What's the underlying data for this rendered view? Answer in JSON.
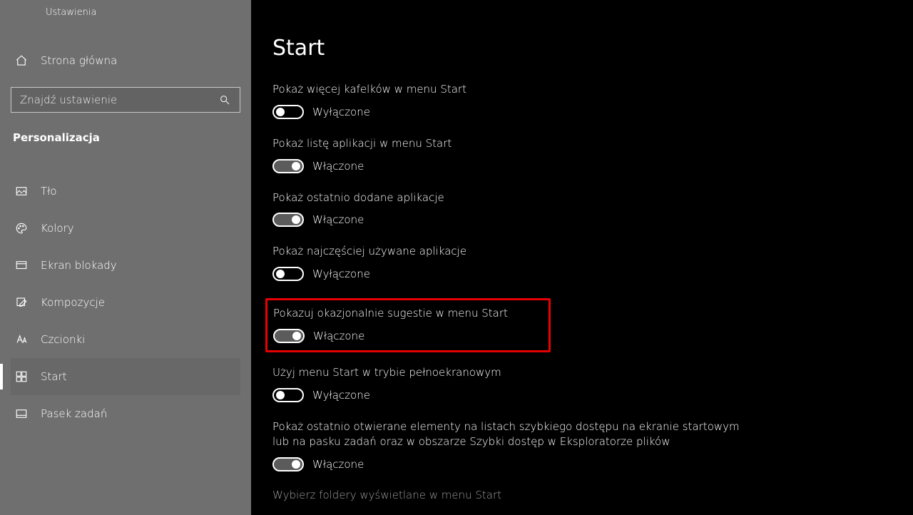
{
  "window": {
    "title": "Ustawienia"
  },
  "sidebar": {
    "home": "Strona główna",
    "search_placeholder": "Znajdź ustawienie",
    "category": "Personalizacja",
    "items": [
      {
        "label": "Tło"
      },
      {
        "label": "Kolory"
      },
      {
        "label": "Ekran blokady"
      },
      {
        "label": "Kompozycje"
      },
      {
        "label": "Czcionki"
      },
      {
        "label": "Start"
      },
      {
        "label": "Pasek zadań"
      }
    ]
  },
  "page": {
    "title": "Start",
    "toggle_on_label": "Włączone",
    "toggle_off_label": "Wyłączone",
    "settings": [
      {
        "label": "Pokaż więcej kafelków w menu Start",
        "on": false
      },
      {
        "label": "Pokaż listę aplikacji w menu Start",
        "on": true
      },
      {
        "label": "Pokaż ostatnio dodane aplikacje",
        "on": true
      },
      {
        "label": "Pokaż najczęściej używane aplikacje",
        "on": false
      },
      {
        "label": "Pokazuj okazjonalnie sugestie w menu Start",
        "on": true,
        "highlight": true
      },
      {
        "label": "Użyj menu Start w trybie pełnoekranowym",
        "on": false
      },
      {
        "label": "Pokaż ostatnio otwierane elementy na listach szybkiego dostępu na ekranie startowym lub na pasku zadań oraz w obszarze Szybki dostęp w Eksploratorze plików",
        "on": true
      }
    ],
    "link": "Wybierz foldery wyświetlane w menu Start"
  }
}
